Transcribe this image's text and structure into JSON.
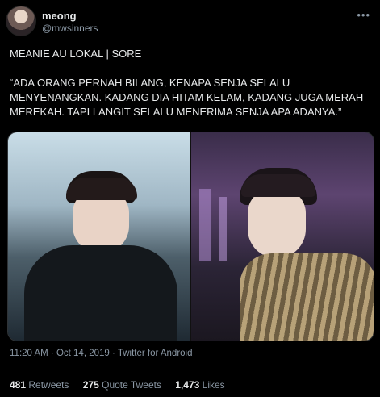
{
  "user": {
    "display_name": "meong",
    "handle": "@mwsinners"
  },
  "more_icon": "more-horizontal-icon",
  "tweet": {
    "text": "MEANIE AU LOKAL | SORE\n\n“ADA ORANG PERNAH BILANG, KENAPA SENJA SELALU MENYENANGKAN. KADANG DIA HITAM KELAM, KADANG JUGA MERAH MEREKAH. TAPI LANGIT SELALU MENERIMA SENJA APA ADANYA.”"
  },
  "meta": {
    "timestamp": "11:20 AM · Oct 14, 2019 · Twitter for Android"
  },
  "stats": {
    "retweets_count": "481",
    "retweets_label": "Retweets",
    "quotes_count": "275",
    "quotes_label": "Quote Tweets",
    "likes_count": "1,473",
    "likes_label": "Likes"
  }
}
